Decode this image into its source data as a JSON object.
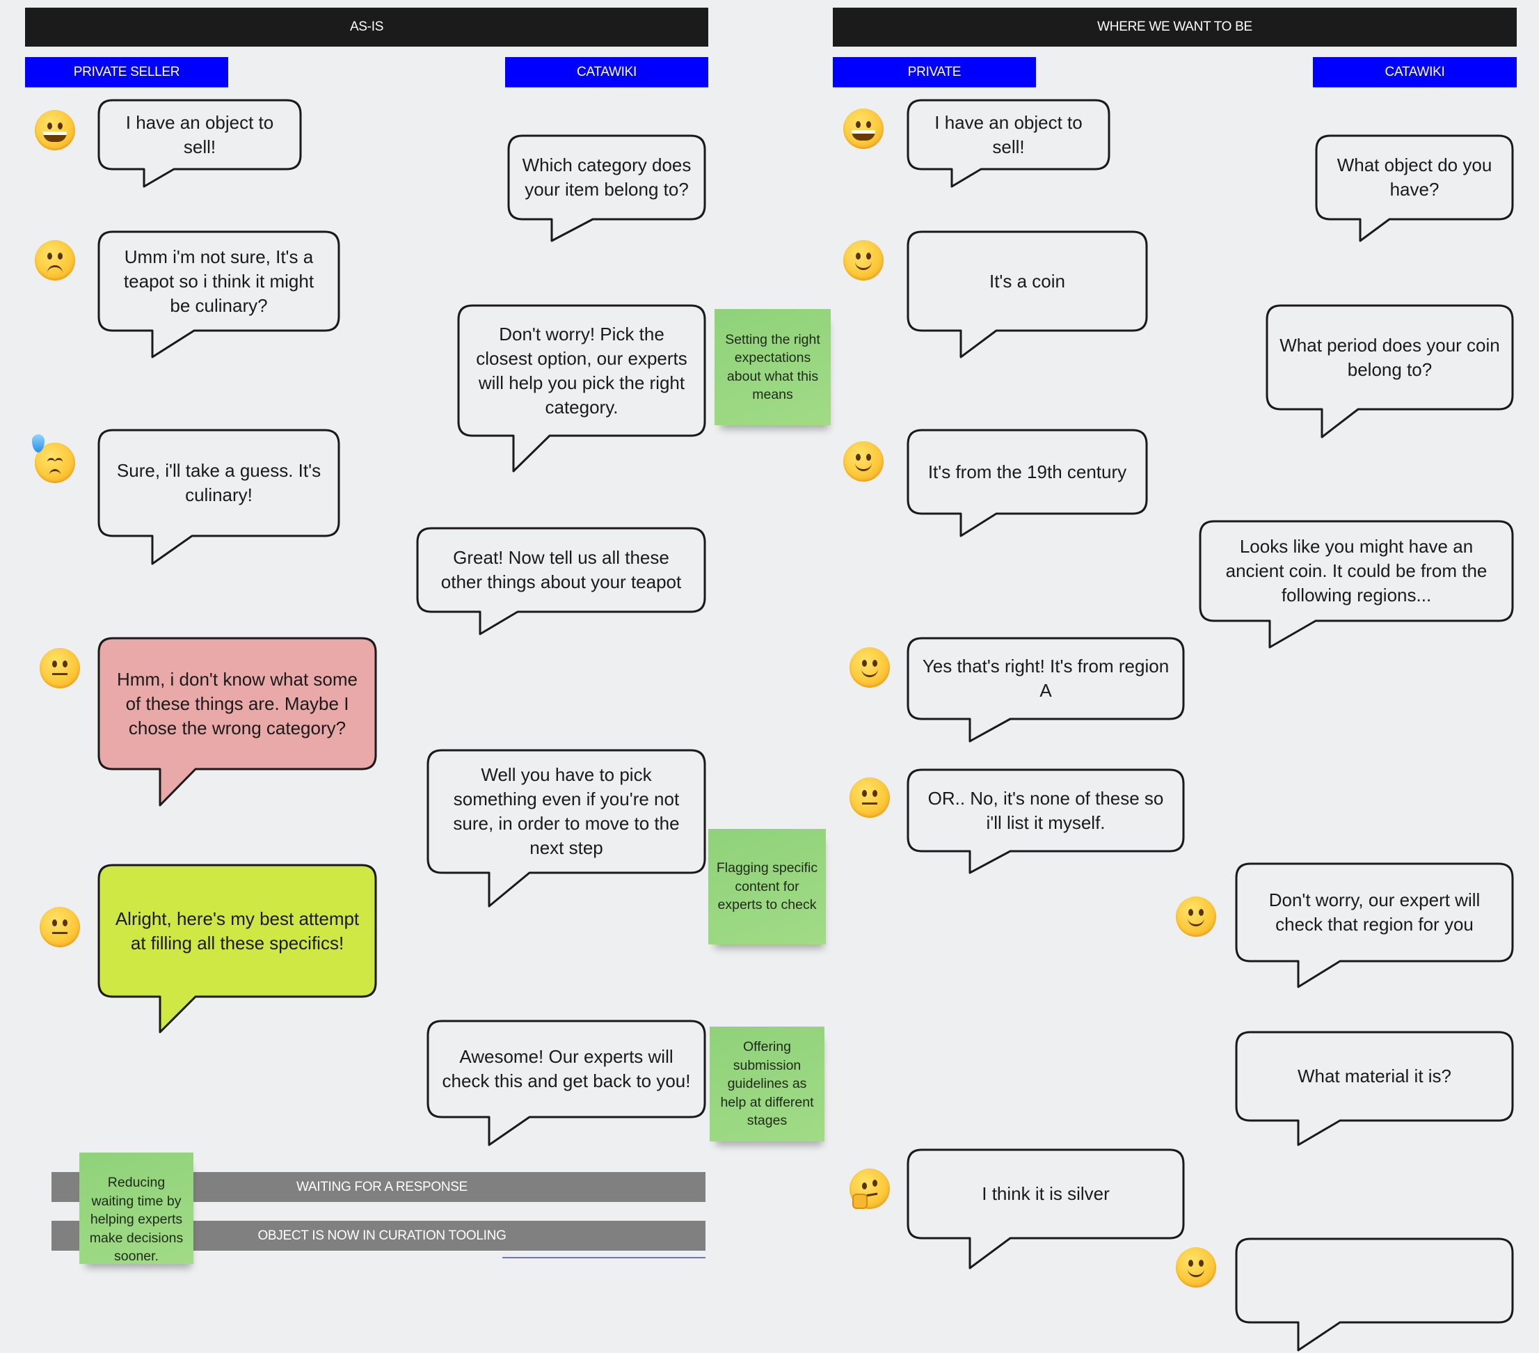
{
  "sections": {
    "as_is": {
      "title": "AS-IS",
      "lanes": {
        "left": "PRIVATE SELLER",
        "right": "CATAWIKI"
      },
      "messages": [
        {
          "side": "seller",
          "text": "I have an object  to sell!",
          "emoji": "grinning-face",
          "fill": "#eeeff1"
        },
        {
          "side": "catawiki",
          "text": "Which category does your item belong to?",
          "fill": "#eeeff1"
        },
        {
          "side": "seller",
          "text": "Umm i'm not sure, It's a teapot so i think it might be culinary?",
          "emoji": "confused-face",
          "fill": "#eeeff1"
        },
        {
          "side": "catawiki",
          "text": "Don't worry! Pick the closest option, our experts will help you pick the right category.",
          "fill": "#eeeff1"
        },
        {
          "side": "seller",
          "text": "Sure, i'll take a guess. It's culinary!",
          "emoji": "downcast-sweat-face",
          "fill": "#eeeff1"
        },
        {
          "side": "catawiki",
          "text": "Great! Now tell us all these other things about your teapot",
          "fill": "#eeeff1"
        },
        {
          "side": "seller",
          "text": "Hmm, i don't know what some of these things are. Maybe I chose the wrong category?",
          "emoji": "neutral-face",
          "fill": "#eaa9a9"
        },
        {
          "side": "catawiki",
          "text": "Well you have to pick something even if you're not sure, in order to move to the next step",
          "fill": "#eeeff1"
        },
        {
          "side": "seller",
          "text": "Alright, here's my best attempt at filling all these specifics!",
          "emoji": "neutral-face",
          "fill": "#d0e843"
        },
        {
          "side": "catawiki",
          "text": "Awesome! Our experts will check this and get back to you!",
          "fill": "#eeeff1"
        }
      ],
      "sticky_notes": [
        "Setting the right expectations about what this means",
        "Flagging specific content for experts to check",
        "Offering submission guidelines as help at different stages",
        "Reducing waiting time by helping experts make decisions sooner."
      ],
      "status_bars": [
        "WAITING FOR A RESPONSE",
        "OBJECT IS NOW IN CURATION TOOLING"
      ]
    },
    "to_be": {
      "title": "WHERE WE WANT TO BE",
      "lanes": {
        "left": "PRIVATE",
        "right": "CATAWIKI"
      },
      "messages": [
        {
          "side": "private",
          "text": "I have an object  to sell!",
          "emoji": "grinning-face"
        },
        {
          "side": "catawiki",
          "text": "What object do you have?"
        },
        {
          "side": "private",
          "text": "It's a coin",
          "emoji": "slightly-smiling-face"
        },
        {
          "side": "catawiki",
          "text": "What period does your coin belong to?"
        },
        {
          "side": "private",
          "text": "It's from the 19th century",
          "emoji": "slightly-smiling-face"
        },
        {
          "side": "catawiki",
          "text": "Looks like you might have an ancient coin. It could be from the following regions..."
        },
        {
          "side": "private",
          "text": "Yes that's right! It's from region A",
          "emoji": "slightly-smiling-face"
        },
        {
          "side": "private",
          "text": "OR.. No, it's none of these so i'll list it myself.",
          "emoji": "neutral-face"
        },
        {
          "side": "catawiki",
          "text": "Don't worry, our expert will check that region for you",
          "emoji": "slightly-smiling-face"
        },
        {
          "side": "catawiki",
          "text": "What material it is?"
        },
        {
          "side": "private",
          "text": "I think it is silver",
          "emoji": "thinking-face"
        },
        {
          "side": "catawiki",
          "text": "",
          "emoji": "slightly-smiling-face"
        }
      ]
    }
  },
  "colors": {
    "header_bg": "#1b1b1b",
    "lane_label_bg": "#0000ff",
    "sticky_note": "#98d681",
    "status_bar": "#808080",
    "canvas_bg": "#eeeff1"
  }
}
